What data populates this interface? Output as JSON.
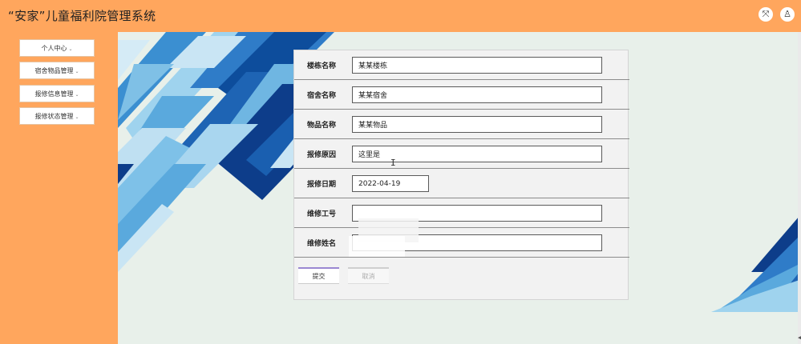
{
  "app": {
    "title": "“安家”儿童福利院管理系统",
    "icons": [
      "fullscreen-icon",
      "user-icon"
    ]
  },
  "sidebar": {
    "items": [
      {
        "label": "个人中心"
      },
      {
        "label": "宿舍物品管理"
      },
      {
        "label": "报修信息管理"
      },
      {
        "label": "报修状态管理"
      }
    ],
    "caret": "⌄"
  },
  "form": {
    "fields": [
      {
        "label": "楼栋名称",
        "value": "某某楼栋"
      },
      {
        "label": "宿舍名称",
        "value": "某某宿舍"
      },
      {
        "label": "物品名称",
        "value": "某某物品"
      },
      {
        "label": "报修原因",
        "value": "这里是"
      },
      {
        "label": "报修日期",
        "value": "2022-04-19"
      },
      {
        "label": "维修工号",
        "value": ""
      },
      {
        "label": "维修姓名",
        "value": ""
      }
    ],
    "submit_label": "提交",
    "cancel_label": "取消"
  },
  "colors": {
    "orange": "#ffa65d",
    "background": "#e8f0ea",
    "decoration_blue": "#1e64b4",
    "decoration_dark_blue": "#0d3d8a",
    "decoration_light_blue": "#7fc0e6"
  }
}
